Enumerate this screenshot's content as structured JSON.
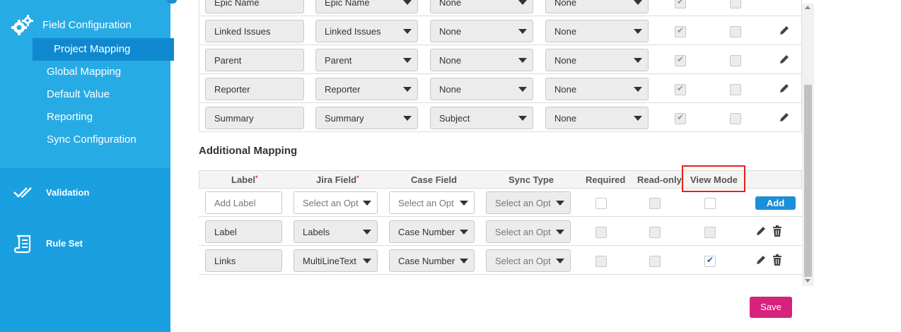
{
  "sidebar": {
    "field_configuration": "Field Configuration",
    "sub_items": [
      "Project Mapping",
      "Global Mapping",
      "Default Value",
      "Reporting",
      "Sync Configuration"
    ],
    "validation": "Validation",
    "rule_set": "Rule Set",
    "colors": {
      "background": "#1a9fe0",
      "top": "#27abe5",
      "active": "#1088cf"
    }
  },
  "mapping_rows": [
    {
      "label": "Epic Name",
      "jira": "Epic Name",
      "case": "None",
      "sync": "None"
    },
    {
      "label": "Linked Issues",
      "jira": "Linked Issues",
      "case": "None",
      "sync": "None"
    },
    {
      "label": "Parent",
      "jira": "Parent",
      "case": "None",
      "sync": "None"
    },
    {
      "label": "Reporter",
      "jira": "Reporter",
      "case": "None",
      "sync": "None"
    },
    {
      "label": "Summary",
      "jira": "Summary",
      "case": "Subject",
      "sync": "None"
    }
  ],
  "additional": {
    "title": "Additional Mapping",
    "headers": {
      "label": "Label",
      "jira": "Jira Field",
      "case": "Case Field",
      "sync": "Sync Type",
      "required": "Required",
      "readonly": "Read-only",
      "viewmode": "View Mode",
      "required_mark": "*"
    },
    "new_row": {
      "label_placeholder": "Add Label",
      "jira": "Select an Opt",
      "case": "Select an Opt",
      "sync": "Select an Opt",
      "add": "Add"
    },
    "rows": [
      {
        "label": "Label",
        "jira": "Labels",
        "case": "Case Number",
        "sync": "Select an Opt",
        "viewmode": false
      },
      {
        "label": "Links",
        "jira": "MultiLineText",
        "case": "Case Number",
        "sync": "Select an Opt",
        "viewmode": true
      }
    ]
  },
  "save": "Save",
  "colors": {
    "add": "#1b8fd8",
    "save": "#d6217d",
    "highlight": "#e8201e"
  }
}
